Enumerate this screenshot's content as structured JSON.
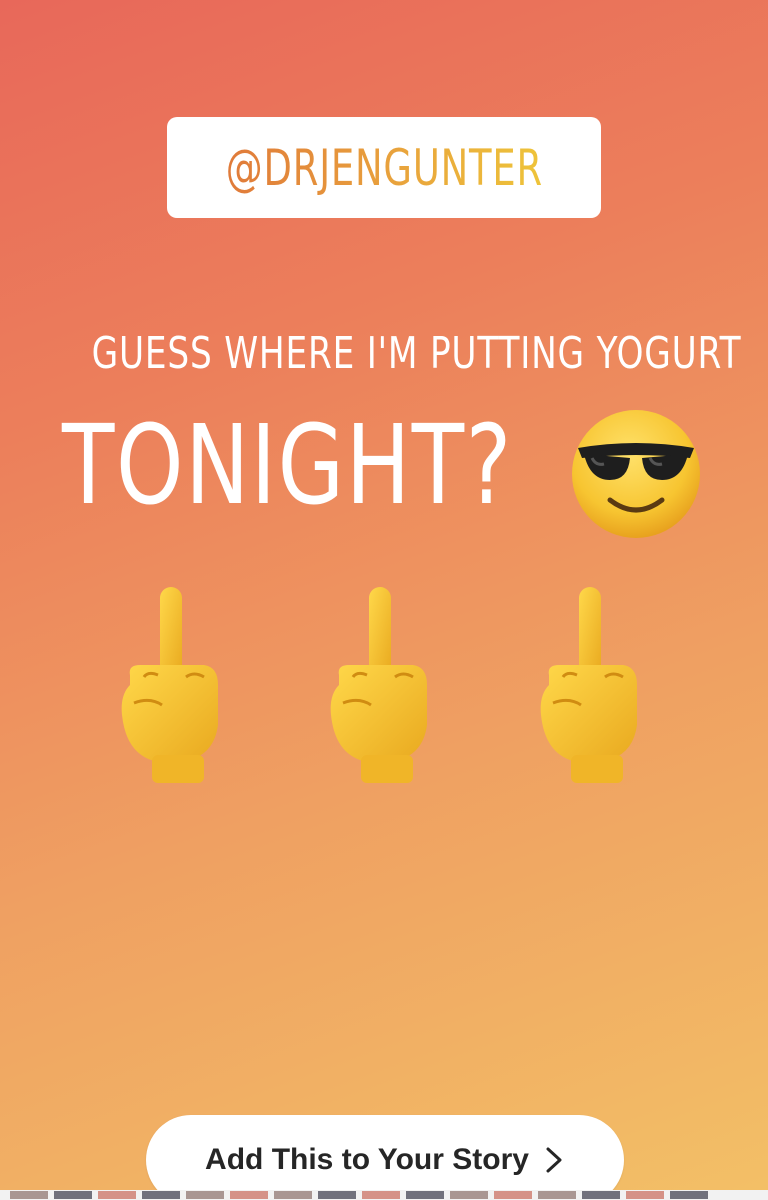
{
  "story": {
    "mention": "@DRJENGUNTER",
    "caption_line1": "GUESS WHERE I'M PUTTING YOGURT",
    "caption_line2": "TONIGHT?",
    "emojis": [
      "sunglasses-face",
      "middle-finger",
      "middle-finger",
      "middle-finger"
    ]
  },
  "cta": {
    "label": "Add This to Your Story"
  },
  "colors": {
    "gradient_top": "#e8685a",
    "gradient_bottom": "#f3c066",
    "mention_gradient_start": "#e07a3a",
    "mention_gradient_end": "#eec43a",
    "emoji_yellow": "#f5c531"
  }
}
